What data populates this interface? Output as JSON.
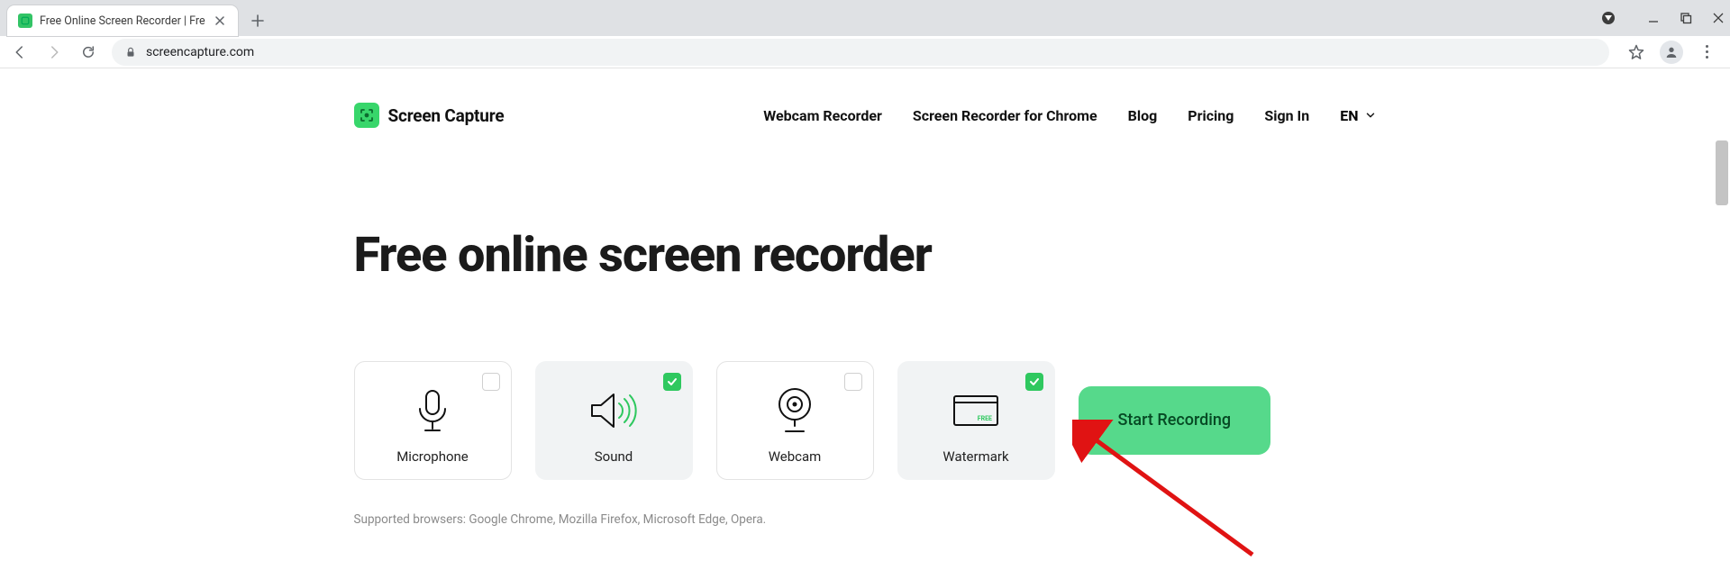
{
  "browser": {
    "tab_title": "Free Online Screen Recorder | Fre",
    "url": "screencapture.com"
  },
  "header": {
    "brand": "Screen Capture",
    "nav": {
      "webcam": "Webcam Recorder",
      "chrome": "Screen Recorder for Chrome",
      "blog": "Blog",
      "pricing": "Pricing",
      "signin": "Sign In",
      "lang": "EN"
    }
  },
  "hero": {
    "title": "Free online screen recorder"
  },
  "options": {
    "microphone": {
      "label": "Microphone",
      "checked": false
    },
    "sound": {
      "label": "Sound",
      "checked": true
    },
    "webcam": {
      "label": "Webcam",
      "checked": false
    },
    "watermark": {
      "label": "Watermark",
      "checked": true
    }
  },
  "start_button": "Start Recording",
  "supported": "Supported browsers: Google Chrome, Mozilla Firefox, Microsoft Edge, Opera."
}
